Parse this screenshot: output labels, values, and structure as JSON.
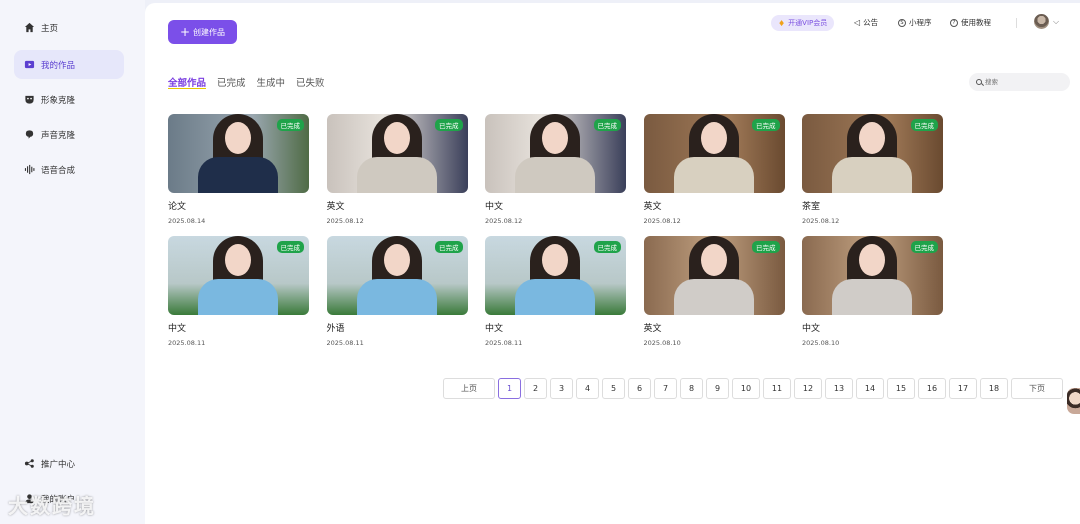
{
  "sidebar": {
    "items": [
      {
        "label": "主页",
        "icon": "home-icon"
      },
      {
        "label": "我的作品",
        "icon": "video-icon"
      },
      {
        "label": "形象克隆",
        "icon": "mask-icon"
      },
      {
        "label": "声音克隆",
        "icon": "speech-icon"
      },
      {
        "label": "语音合成",
        "icon": "waveform-icon"
      }
    ],
    "bottom": [
      {
        "label": "推广中心",
        "icon": "share-icon"
      },
      {
        "label": "我的账户",
        "icon": "user-icon"
      }
    ]
  },
  "header": {
    "create_label": "创建作品",
    "vip_label": "开通VIP会员",
    "notice_label": "公告",
    "miniapp_label": "小程序",
    "tutorial_label": "使用教程"
  },
  "tabs": [
    "全部作品",
    "已完成",
    "生成中",
    "已失败"
  ],
  "search": {
    "placeholder": "搜索"
  },
  "works": [
    {
      "title": "论文",
      "date": "2025.08.14",
      "status": "已完成"
    },
    {
      "title": "英文",
      "date": "2025.08.12",
      "status": "已完成"
    },
    {
      "title": "中文",
      "date": "2025.08.12",
      "status": "已完成"
    },
    {
      "title": "英文",
      "date": "2025.08.12",
      "status": "已完成"
    },
    {
      "title": "茶室",
      "date": "2025.08.12",
      "status": "已完成"
    },
    {
      "title": "中文",
      "date": "2025.08.11",
      "status": "已完成"
    },
    {
      "title": "外语",
      "date": "2025.08.11",
      "status": "已完成"
    },
    {
      "title": "中文",
      "date": "2025.08.11",
      "status": "已完成"
    },
    {
      "title": "英文",
      "date": "2025.08.10",
      "status": "已完成"
    },
    {
      "title": "中文",
      "date": "2025.08.10",
      "status": "已完成"
    }
  ],
  "pagination": {
    "prev": "上页",
    "next": "下页",
    "pages": [
      "1",
      "2",
      "3",
      "4",
      "5",
      "6",
      "7",
      "8",
      "9",
      "10",
      "11",
      "12",
      "13",
      "14",
      "15",
      "16",
      "17",
      "18"
    ],
    "current": "1"
  },
  "watermark": "大数跨境",
  "colors": {
    "accent": "#7b4fe9",
    "badge": "#1fa34a"
  }
}
